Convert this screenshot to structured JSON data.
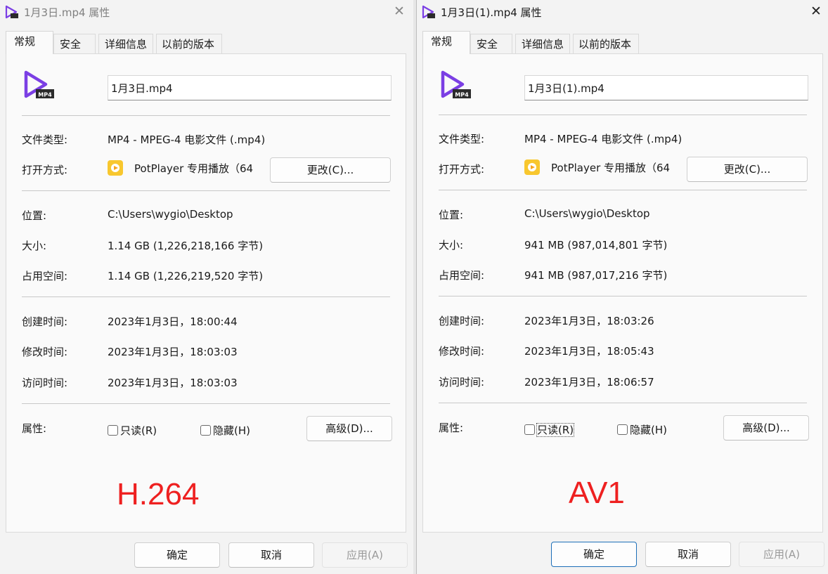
{
  "windows": [
    {
      "title": "1月3日.mp4 属性",
      "close_glyph": "✕",
      "tabs": [
        "常规",
        "安全",
        "详细信息",
        "以前的版本"
      ],
      "file_name": "1月3日.mp4",
      "icon_badge": "MP4",
      "fields": {
        "type_label": "文件类型:",
        "type_value": "MP4 - MPEG-4 电影文件 (.mp4)",
        "opens_label": "打开方式:",
        "opens_value": "PotPlayer 专用播放（64",
        "change_button": "更改(C)...",
        "location_label": "位置:",
        "location_value": "C:\\Users\\wygio\\Desktop",
        "size_label": "大小:",
        "size_value": "1.14 GB (1,226,218,166 字节)",
        "ondisk_label": "占用空间:",
        "ondisk_value": "1.14 GB (1,226,219,520 字节)",
        "created_label": "创建时间:",
        "created_value": "2023年1月3日，18:00:44",
        "modified_label": "修改时间:",
        "modified_value": "2023年1月3日，18:03:03",
        "accessed_label": "访问时间:",
        "accessed_value": "2023年1月3日，18:03:03",
        "attr_label": "属性:",
        "readonly_label": "只读(R)",
        "hidden_label": "隐藏(H)",
        "advanced_button": "高级(D)..."
      },
      "codec_annotation": "H.264",
      "buttons": {
        "ok": "确定",
        "cancel": "取消",
        "apply": "应用(A)"
      }
    },
    {
      "title": "1月3日(1).mp4 属性",
      "close_glyph": "✕",
      "tabs": [
        "常规",
        "安全",
        "详细信息",
        "以前的版本"
      ],
      "file_name": "1月3日(1).mp4",
      "icon_badge": "MP4",
      "fields": {
        "type_label": "文件类型:",
        "type_value": "MP4 - MPEG-4 电影文件 (.mp4)",
        "opens_label": "打开方式:",
        "opens_value": "PotPlayer 专用播放（64",
        "change_button": "更改(C)...",
        "location_label": "位置:",
        "location_value": "C:\\Users\\wygio\\Desktop",
        "size_label": "大小:",
        "size_value": "941 MB (987,014,801 字节)",
        "ondisk_label": "占用空间:",
        "ondisk_value": "941 MB (987,017,216 字节)",
        "created_label": "创建时间:",
        "created_value": "2023年1月3日，18:03:26",
        "modified_label": "修改时间:",
        "modified_value": "2023年1月3日，18:05:43",
        "accessed_label": "访问时间:",
        "accessed_value": "2023年1月3日，18:06:57",
        "attr_label": "属性:",
        "readonly_label": "只读(R)",
        "hidden_label": "隐藏(H)",
        "advanced_button": "高级(D)..."
      },
      "codec_annotation": "AV1",
      "buttons": {
        "ok": "确定",
        "cancel": "取消",
        "apply": "应用(A)"
      }
    }
  ],
  "colors": {
    "accent_purple": "#7b3fe4",
    "potplayer_yellow": "#f8c72e",
    "annotation_red": "#ee2020",
    "ok_button_border": "#1d6fb8"
  },
  "icons": [
    "video-file-icon",
    "potplayer-icon",
    "close-icon",
    "checkbox-icon"
  ]
}
